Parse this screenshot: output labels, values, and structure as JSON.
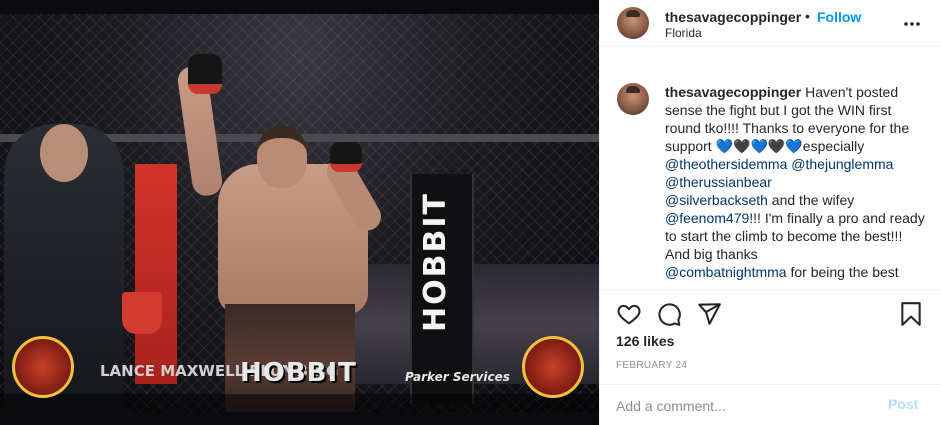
{
  "post": {
    "username": "thesavagecoppinger",
    "separator": "•",
    "follow_label": "Follow",
    "location": "Florida",
    "more_icon": "more-horizontal-icon"
  },
  "photo": {
    "pillar_text": "HOBBIT",
    "sponsor_hobbit": "HOBBIT",
    "sponsor_plumbing": "LANCE MAXWELL PLUMBING",
    "sponsor_parker": "Parker Services"
  },
  "caption": {
    "username": "thesavagecoppinger",
    "text_1": "Haven't posted sense the fight but I got the WIN first round tko!!!! Thanks to everyone for the support ",
    "hearts_a": "💙",
    "hearts_b": "🖤",
    "hearts_c": "💙",
    "hearts_d": "🖤",
    "hearts_e": "💙",
    "text_2": "especially",
    "mention_1": "@theothersidemma",
    "mention_2": "@thejunglemma",
    "mention_3": "@therussianbear",
    "mention_4": "@silverbackseth",
    "text_3": " and the wifey",
    "mention_5": "@feenom479",
    "text_4": "!!! I'm finally a pro and ready to start the climb to become the best!!! And big thanks",
    "mention_6": "@combatnightmma",
    "text_5": " for being the best"
  },
  "actions": {
    "like_icon": "heart-icon",
    "comment_icon": "comment-bubble-icon",
    "share_icon": "paper-plane-icon",
    "save_icon": "bookmark-icon"
  },
  "likes": "126 likes",
  "date": "FEBRUARY 24",
  "comment": {
    "placeholder": "Add a comment...",
    "post_label": "Post"
  },
  "colors": {
    "link": "#0095f6",
    "mention": "#00376b",
    "muted": "#8e8e8e",
    "post_disabled": "#b2dffc"
  }
}
